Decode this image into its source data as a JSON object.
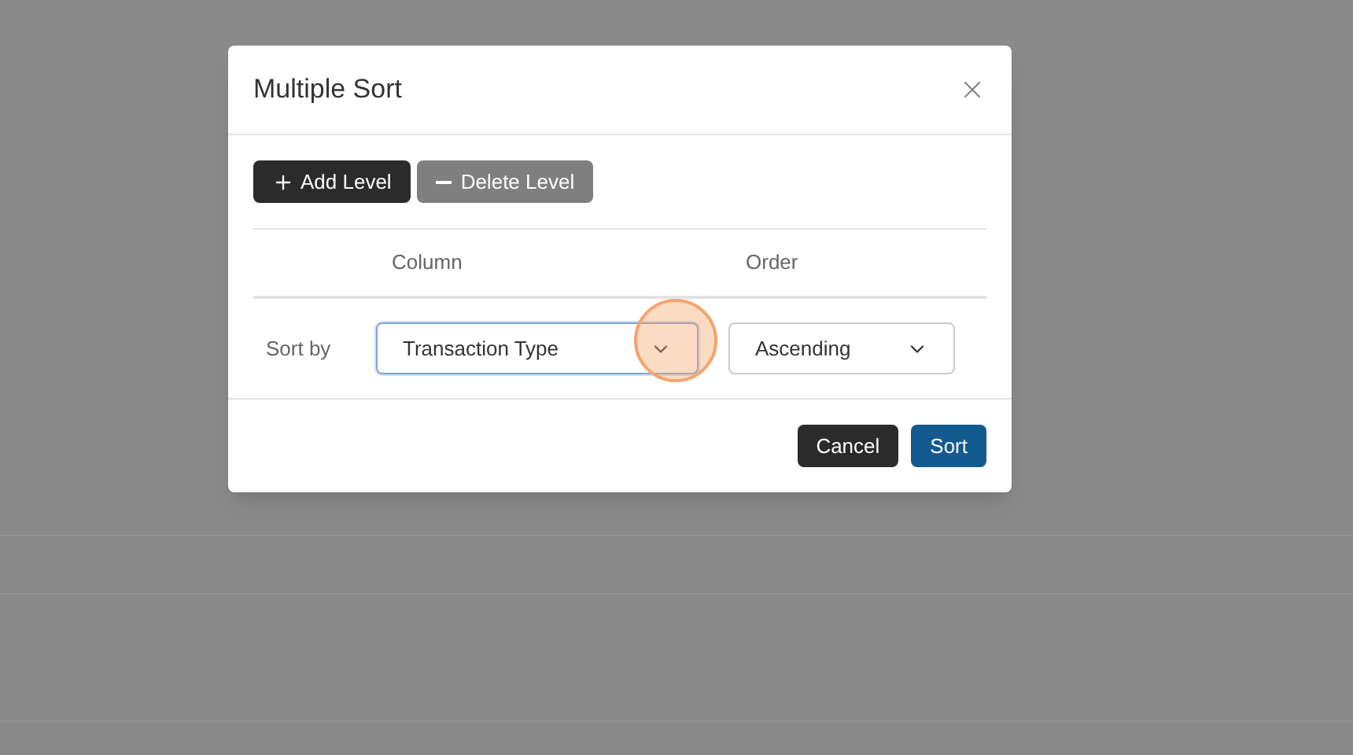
{
  "dialog": {
    "title": "Multiple Sort",
    "toolbar": [
      {
        "label": "Add Level",
        "kind": "add",
        "disabled": false
      },
      {
        "label": "Delete Level",
        "kind": "delete",
        "disabled": true
      }
    ],
    "columns": [
      "Column",
      "Order"
    ],
    "rows": [
      {
        "label": "Sort by",
        "column": "Transaction Type",
        "order": "Ascending",
        "focused": true
      }
    ],
    "buttons": [
      {
        "label": "Cancel",
        "kind": "secondary"
      },
      {
        "label": "Sort",
        "kind": "primary"
      }
    ]
  }
}
